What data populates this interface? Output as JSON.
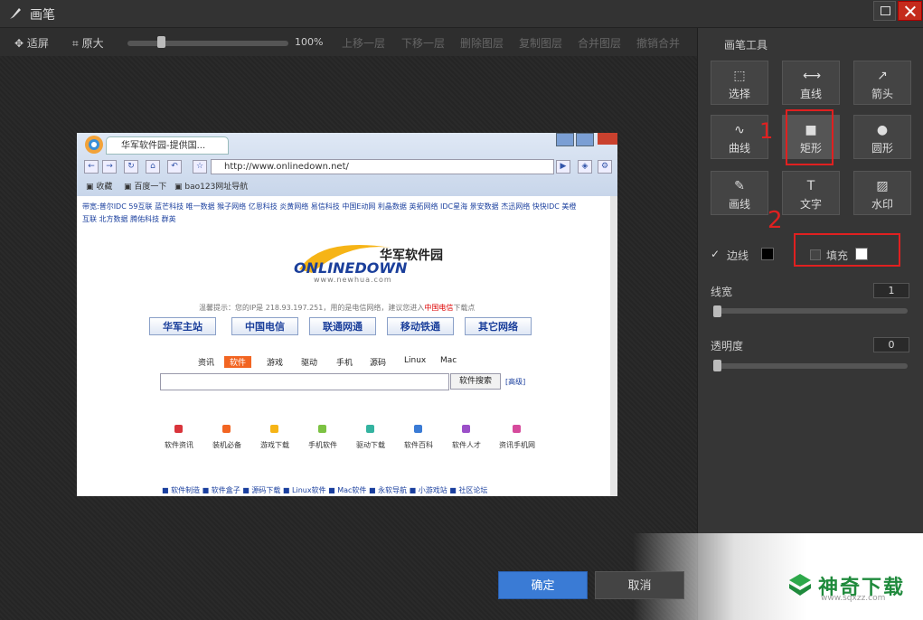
{
  "window": {
    "title": "画笔"
  },
  "toolbar": {
    "fit": "适屏",
    "original": "原大",
    "zoom": "100%",
    "move_up": "上移一层",
    "move_down": "下移一层",
    "delete_layer": "删除图层",
    "copy_layer": "复制图层",
    "merge_layer": "合并图层",
    "undo_merge": "撤销合并"
  },
  "panel": {
    "title": "画笔工具",
    "tools": [
      {
        "label": "选择",
        "icon": "select-icon"
      },
      {
        "label": "直线",
        "icon": "line-icon"
      },
      {
        "label": "箭头",
        "icon": "arrow-icon"
      },
      {
        "label": "曲线",
        "icon": "curve-icon"
      },
      {
        "label": "矩形",
        "icon": "rectangle-icon"
      },
      {
        "label": "圆形",
        "icon": "circle-icon"
      },
      {
        "label": "画线",
        "icon": "brush-icon"
      },
      {
        "label": "文字",
        "icon": "text-icon"
      },
      {
        "label": "水印",
        "icon": "watermark-icon"
      }
    ],
    "border_label": "边线",
    "border_checked": true,
    "border_color": "#000000",
    "fill_label": "填充",
    "fill_checked": false,
    "fill_color": "#ffffff",
    "line_width_label": "线宽",
    "line_width_value": "1",
    "opacity_label": "透明度",
    "opacity_value": "0",
    "annotations": [
      "1",
      "2"
    ]
  },
  "dialog": {
    "ok": "确定",
    "cancel": "取消"
  },
  "watermark": {
    "name": "神奇下载",
    "url": "www.sqxzz.com"
  },
  "screenshot": {
    "tab_title": "华军软件园-提供国...",
    "address": "http://www.onlinedown.net/",
    "favorites": [
      "收藏",
      "百度一下",
      "bao123网址导航"
    ],
    "links_line1": "带宽:普尔IDC 59互联 蓝芒科技 唯一数据 猴子网络 亿恩科技 炎黄网络 易信科技 中国E动网 利晶数据 英拓网络 IDC星海 景安数据 杰迅网络 快快IDC 美橙",
    "links_line2": "互联 北方数据 腾佑科技 群英",
    "brand_cn": "华军软件园",
    "brand_en": "ONLINEDOWN",
    "brand_url": "www.newhua.com",
    "tip_prefix": "温馨提示：您的IP是 218.93.197.251，用的是电信网络，建议您进入",
    "tip_em": "中国电信",
    "tip_suffix": "下载点",
    "nav_buttons": [
      "华军主站",
      "中国电信",
      "联通网通",
      "移动铁通",
      "其它网络"
    ],
    "categories": [
      "资讯",
      "软件",
      "游戏",
      "驱动",
      "手机",
      "源码",
      "Linux",
      "Mac"
    ],
    "active_category": "软件",
    "search_button": "软件搜索",
    "search_advanced": "[高级]",
    "quick_links": [
      "软件资讯",
      "装机必备",
      "游戏下载",
      "手机软件",
      "驱动下载",
      "软件百科",
      "软件人才",
      "资讯手机网"
    ],
    "bottom_links": "■ 软件制造   ■ 软件盒子   ■ 源码下载   ■ Linux软件   ■ Mac软件   ■ 永软导航   ■ 小游戏站   ■ 社区论坛"
  }
}
